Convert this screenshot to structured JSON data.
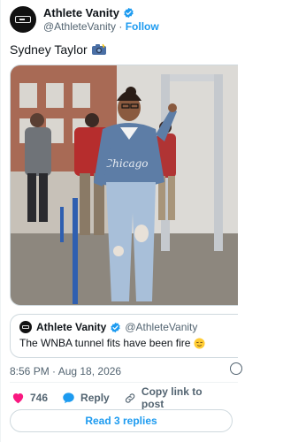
{
  "author": {
    "display_name": "Athlete Vanity",
    "handle": "@AthleteVanity",
    "separator": "·",
    "follow_label": "Follow"
  },
  "post": {
    "text": "Sydney Taylor",
    "emoji": "camera-with-flash"
  },
  "quoted": {
    "display_name": "Athlete Vanity",
    "handle": "@AthleteVanity",
    "text": "The WNBA tunnel fits have been fire",
    "emoji": "relieved-face"
  },
  "meta": {
    "timestamp": "8:56 PM · Aug 18, 2026"
  },
  "actions": {
    "like_count": "746",
    "reply_label": "Reply",
    "copy_link_label": "Copy link to post"
  },
  "replies": {
    "read_label": "Read 3 replies"
  },
  "colors": {
    "accent": "#1d9bf0",
    "like": "#f91880",
    "muted": "#536471"
  }
}
